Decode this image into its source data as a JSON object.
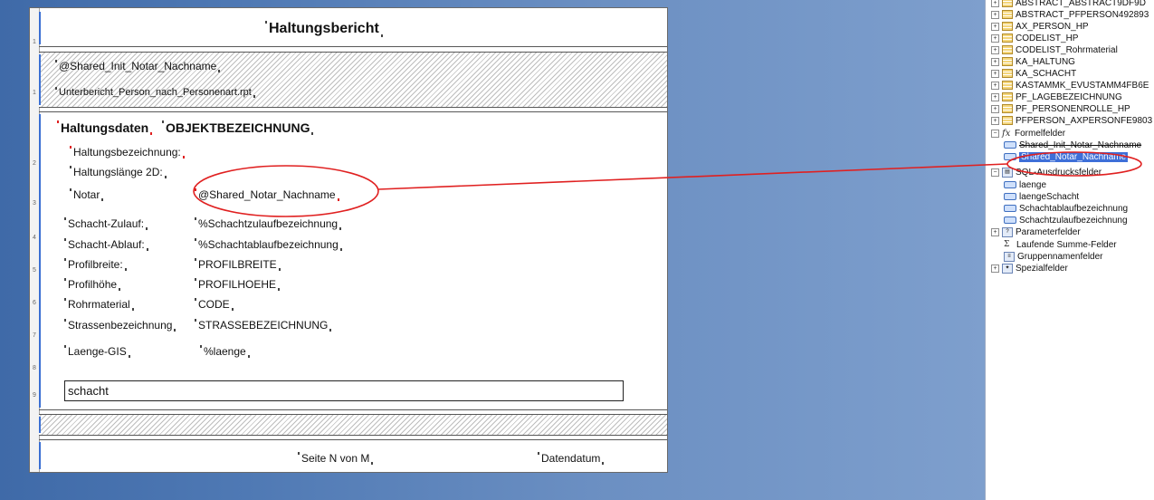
{
  "report": {
    "title": "Haltungsbericht",
    "header_field": "@Shared_Init_Notar_Nachname",
    "subreport": "Unterbericht_Person_nach_Personenart.rpt",
    "section_label": "Haltungsdaten",
    "object_field": "OBJEKTBEZEICHNUNG",
    "label_haltungsbezeichnung": "Haltungsbezeichnung:",
    "label_haltungslaenge": "Haltungslänge 2D:",
    "label_notar": "Notar",
    "notar_field": "@Shared_Notar_Nachname",
    "rows": [
      {
        "label": "Schacht-Zulauf:",
        "value": "%Schachtzulaufbezeichnung"
      },
      {
        "label": "Schacht-Ablauf:",
        "value": "%Schachtablaufbezeichnung"
      },
      {
        "label": "Profilbreite:",
        "value": "PROFILBREITE"
      },
      {
        "label": "Profilhöhe",
        "value": "PROFILHOEHE"
      },
      {
        "label": "Rohrmaterial",
        "value": "CODE"
      },
      {
        "label": "Strassenbezeichnung",
        "value": "STRASSEBEZEICHNUNG"
      }
    ],
    "laenge_label": "Laenge-GIS",
    "laenge_field": "%laenge",
    "schacht_box": "schacht",
    "footer_page": "Seite N von M",
    "footer_date": "Datendatum",
    "ruler_marks": [
      "1",
      "1",
      "2",
      "3",
      "4",
      "5",
      "6",
      "7",
      "8",
      "9"
    ]
  },
  "field_explorer": {
    "tables": [
      "ABSTRACT_ABSTRACT9DF9D",
      "ABSTRACT_PFPERSON492893",
      "AX_PERSON_HP",
      "CODELIST_HP",
      "CODELIST_Rohrmaterial",
      "KA_HALTUNG",
      "KA_SCHACHT",
      "KASTAMMK_EVUSTAMM4FB6E",
      "PF_LAGEBEZEICHNUNG",
      "PF_PERSONENROLLE_HP",
      "PFPERSON_AXPERSONFE9803"
    ],
    "formula_group": "Formelfelder",
    "formula_items": [
      "Shared_Init_Notar_Nachname",
      "Shared_Notar_Nachname"
    ],
    "sql_group": "SQL-Ausdrucksfelder",
    "sql_items": [
      "laenge",
      "laengeSchacht",
      "Schachtablaufbezeichnung",
      "Schachtzulaufbezeichnung"
    ],
    "other_groups": [
      "Parameterfelder",
      "Laufende Summe-Felder",
      "Gruppennamenfelder",
      "Spezialfelder"
    ]
  },
  "colors": {
    "highlight": "#e02020",
    "selection": "#3e6fd8",
    "desktop": "#4f79b4"
  }
}
